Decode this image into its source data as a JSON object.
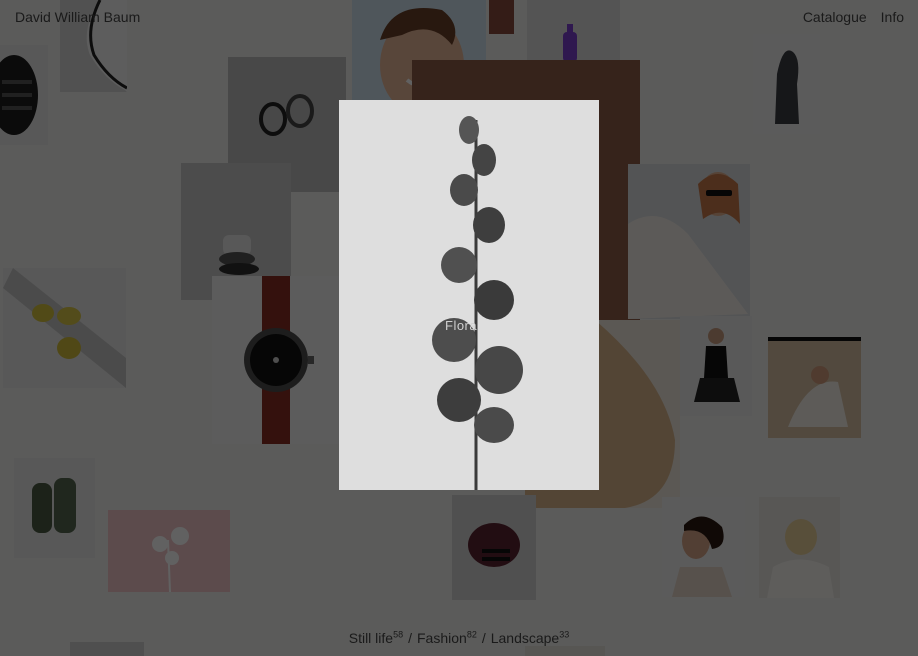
{
  "header": {
    "site_title": "David William Baum",
    "nav": [
      {
        "label": "Catalogue"
      },
      {
        "label": "Info"
      }
    ]
  },
  "focus_label": "Flora",
  "categories": [
    {
      "label": "Still life",
      "count": "58"
    },
    {
      "label": "Fashion",
      "count": "82"
    },
    {
      "label": "Landscape",
      "count": "33"
    }
  ],
  "category_separator": "/",
  "colors": {
    "background": "#f0efed",
    "overlay": "rgba(0,0,0,0.62)",
    "text": "#1a1a1a"
  }
}
